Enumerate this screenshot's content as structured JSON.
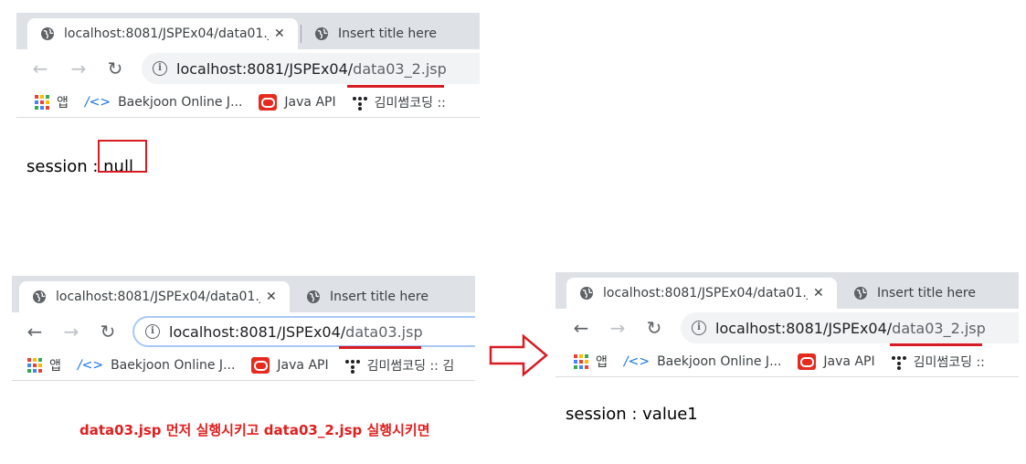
{
  "browsers": [
    {
      "tabs": [
        {
          "title": "localhost:8081/JSPEx04/data01.js",
          "close": "✕"
        },
        {
          "title": "Insert title here"
        }
      ],
      "url_host": "localhost:8081/JSPEx04/",
      "url_path": "data03_2.jsp",
      "bookmarks": {
        "apps": "앱",
        "baekjoon": "Baekjoon Online J...",
        "java_api": "Java API",
        "kimmi": "김미썸코딩 ::"
      },
      "session_label": "session : ",
      "session_value": "null"
    },
    {
      "tabs": [
        {
          "title": "localhost:8081/JSPEx04/data01.js",
          "close": "✕"
        },
        {
          "title": "Insert title here"
        }
      ],
      "url_host": "localhost:8081/JSPEx04/",
      "url_path": "data03.jsp",
      "bookmarks": {
        "apps": "앱",
        "baekjoon": "Baekjoon Online J...",
        "java_api": "Java API",
        "kimmi": "김미썸코딩 :: 김"
      }
    },
    {
      "tabs": [
        {
          "title": "localhost:8081/JSPEx04/data01.js",
          "close": "✕"
        },
        {
          "title": "Insert title here"
        }
      ],
      "url_host": "localhost:8081/JSPEx04/",
      "url_path": "data03_2.jsp",
      "bookmarks": {
        "apps": "앱",
        "baekjoon": "Baekjoon Online J...",
        "java_api": "Java API",
        "kimmi": "김미썸코딩 ::"
      },
      "session_label": "session : ",
      "session_value": "value1"
    }
  ],
  "caption": "data03.jsp 먼저 실행시키고 data03_2.jsp 실행시키면",
  "colors": {
    "annotation_red": "#d71c24",
    "tabstrip": "#dee1e6"
  },
  "icons": [
    "globe-icon",
    "back-arrow-icon",
    "forward-arrow-icon",
    "reload-icon",
    "info-icon",
    "apps-grid-icon",
    "oracle-icon",
    "tistory-icon",
    "right-arrow-icon"
  ]
}
